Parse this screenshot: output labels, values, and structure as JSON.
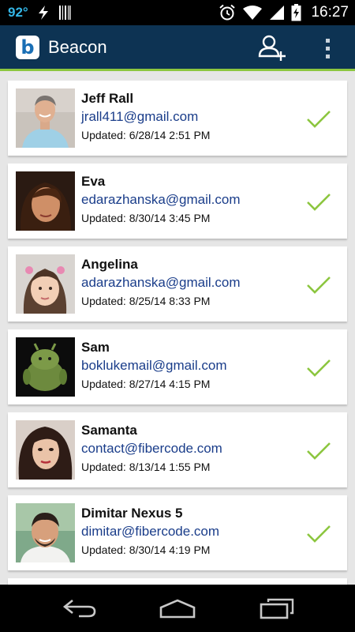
{
  "status_bar": {
    "temperature": "92°",
    "time": "16:27",
    "icons": [
      "bolt-icon",
      "barcode-icon",
      "alarm-icon",
      "wifi-icon",
      "signal-icon",
      "battery-charging-icon"
    ]
  },
  "app_bar": {
    "title": "Beacon",
    "logo_letter": "b",
    "actions": [
      "add-user-icon",
      "overflow-menu-icon"
    ],
    "accent_color": "#8cc63f",
    "bar_color": "#0d3353"
  },
  "contacts": [
    {
      "name": "Jeff Rall",
      "email": "jrall411@gmail.com",
      "updated": "Updated: 6/28/14 2:51 PM",
      "synced": true
    },
    {
      "name": "Eva",
      "email": "edarazhanska@gmail.com",
      "updated": "Updated: 8/30/14 3:45 PM",
      "synced": true
    },
    {
      "name": "Angelina",
      "email": "adarazhanska@gmail.com",
      "updated": "Updated: 8/25/14 8:33 PM",
      "synced": true
    },
    {
      "name": "Sam",
      "email": "boklukemail@gmail.com",
      "updated": "Updated: 8/27/14 4:15 PM",
      "synced": true
    },
    {
      "name": "Samanta",
      "email": "contact@fibercode.com",
      "updated": "Updated: 8/13/14 1:55 PM",
      "synced": true
    },
    {
      "name": "Dimitar Nexus 5",
      "email": "dimitar@fibercode.com",
      "updated": "Updated: 8/30/14 4:19 PM",
      "synced": true
    }
  ],
  "nav_bar": {
    "buttons": [
      "back-icon",
      "home-icon",
      "recent-apps-icon"
    ]
  }
}
